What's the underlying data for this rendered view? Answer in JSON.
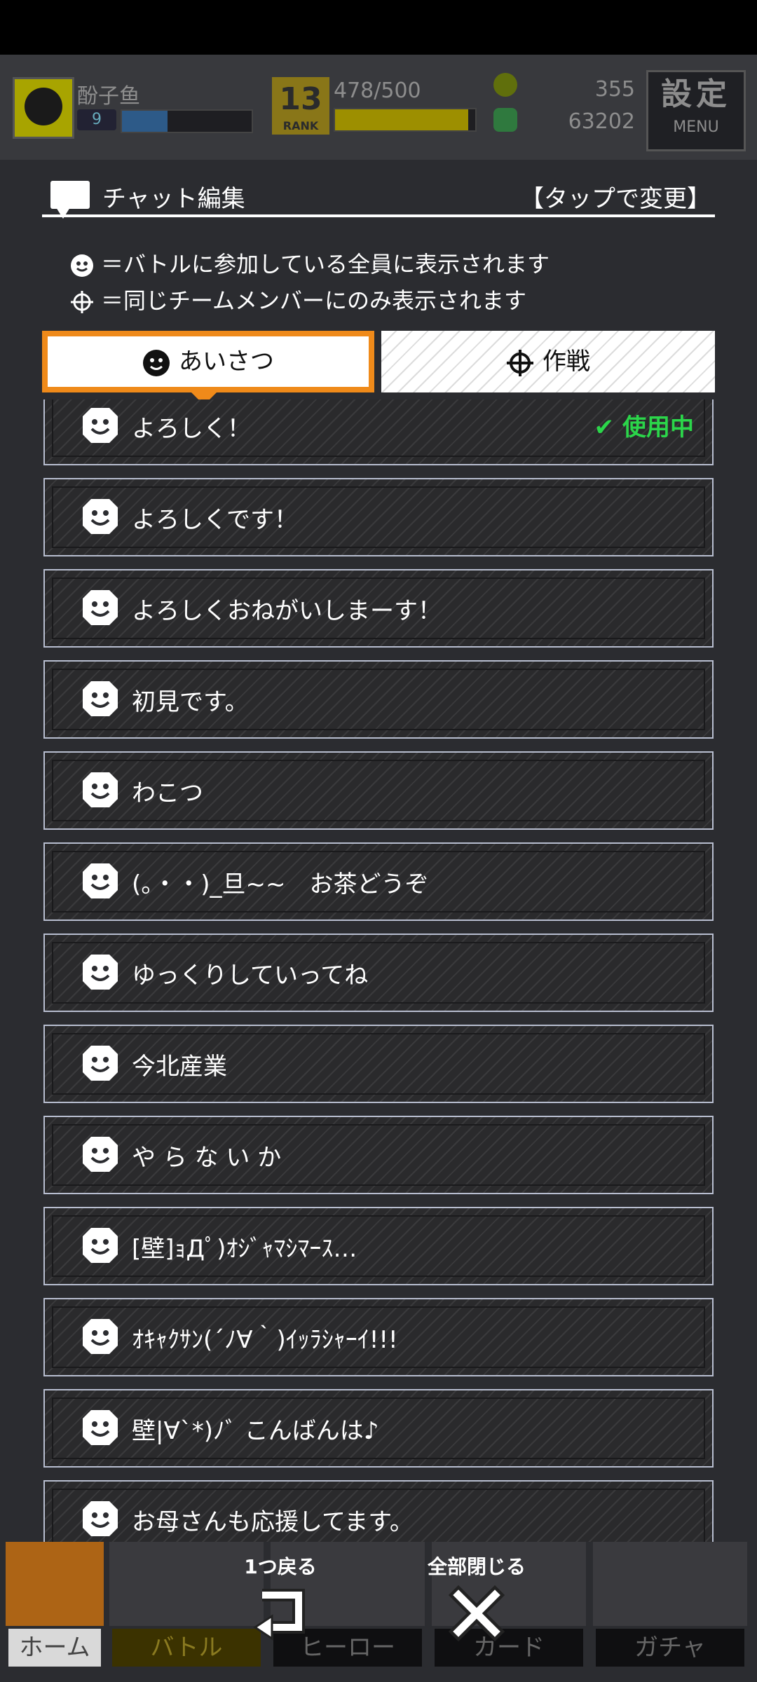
{
  "player": {
    "name": "酚子鱼",
    "level": "9",
    "xp_fraction": 0.35
  },
  "rank": {
    "number": "13",
    "label": "RANK"
  },
  "stamina": {
    "text": "478/500",
    "fraction": 0.95
  },
  "currency": {
    "coins": "355",
    "gems": "63202"
  },
  "settings": {
    "kanji": "設定",
    "menu": "MENU"
  },
  "header": {
    "title": "チャット編集",
    "action": "【タップで変更】"
  },
  "legend": {
    "all": "＝バトルに参加している全員に表示されます",
    "team": "＝同じチームメンバーにのみ表示されます"
  },
  "tabs": {
    "greetings": "あいさつ",
    "strategy": "作戦"
  },
  "chat_items": [
    {
      "label": "よろしく！",
      "status": "使用中"
    },
    {
      "label": "よろしくです！"
    },
    {
      "label": "よろしくおねがいしまーす！"
    },
    {
      "label": "初見です。"
    },
    {
      "label": "わこつ"
    },
    {
      "label": "(。・・)_旦~~　お茶どうぞ"
    },
    {
      "label": "ゆっくりしていってね"
    },
    {
      "label": "今北産業"
    },
    {
      "label": "や ら な い か"
    },
    {
      "label": "[壁]ｮДﾟ)ｵｼﾞｬﾏｼﾏｰｽ…"
    },
    {
      "label": "ｵｷｬｸｻﾝ(´ﾉ∀｀)ｲｯﾗｼｬｰｲ!!!"
    },
    {
      "label": "壁|∀`*)ﾉﾞ こんばんは♪"
    },
    {
      "label": "お母さんも応援してます。"
    }
  ],
  "bottom_nav": {
    "home": "ホーム",
    "battle": "バトル",
    "hero": "ヒーロー",
    "card": "カード",
    "gacha": "ガチャ",
    "back": "1つ戻る",
    "close_all": "全部閉じる"
  }
}
